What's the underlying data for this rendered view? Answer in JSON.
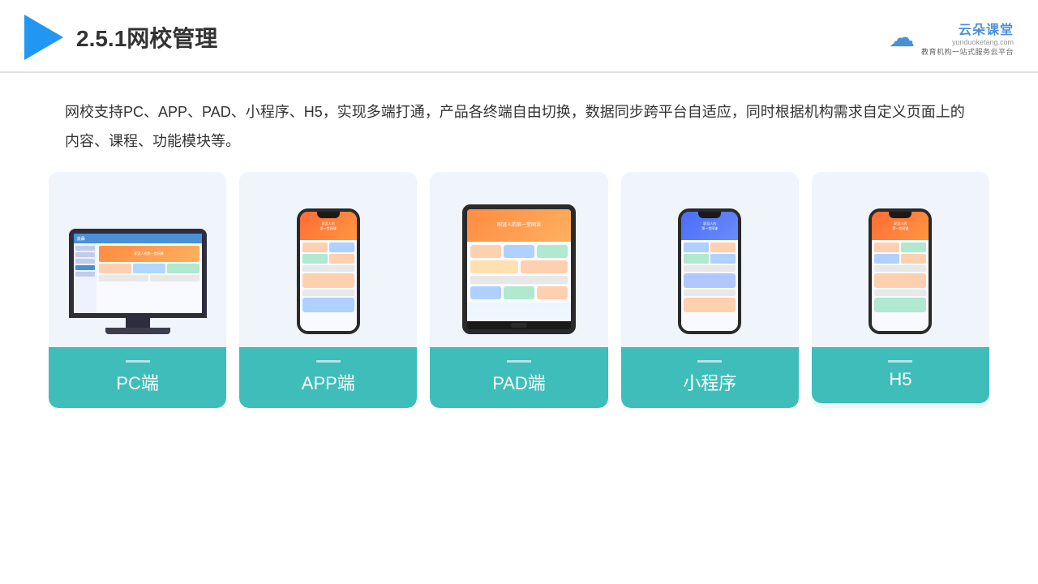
{
  "header": {
    "title": "2.5.1网校管理",
    "brand_name": "云朵课堂",
    "brand_url": "yunduoketang.com",
    "brand_tagline": "教育机构一站式服务云平台"
  },
  "description": "网校支持PC、APP、PAD、小程序、H5，实现多端打通，产品各终端自由切换，数据同步跨平台自适应，同时根据机构需求自定义页面上的内容、课程、功能模块等。",
  "devices": [
    {
      "id": "pc",
      "label": "PC端"
    },
    {
      "id": "app",
      "label": "APP端"
    },
    {
      "id": "pad",
      "label": "PAD端"
    },
    {
      "id": "miniprogram",
      "label": "小程序"
    },
    {
      "id": "h5",
      "label": "H5"
    }
  ]
}
